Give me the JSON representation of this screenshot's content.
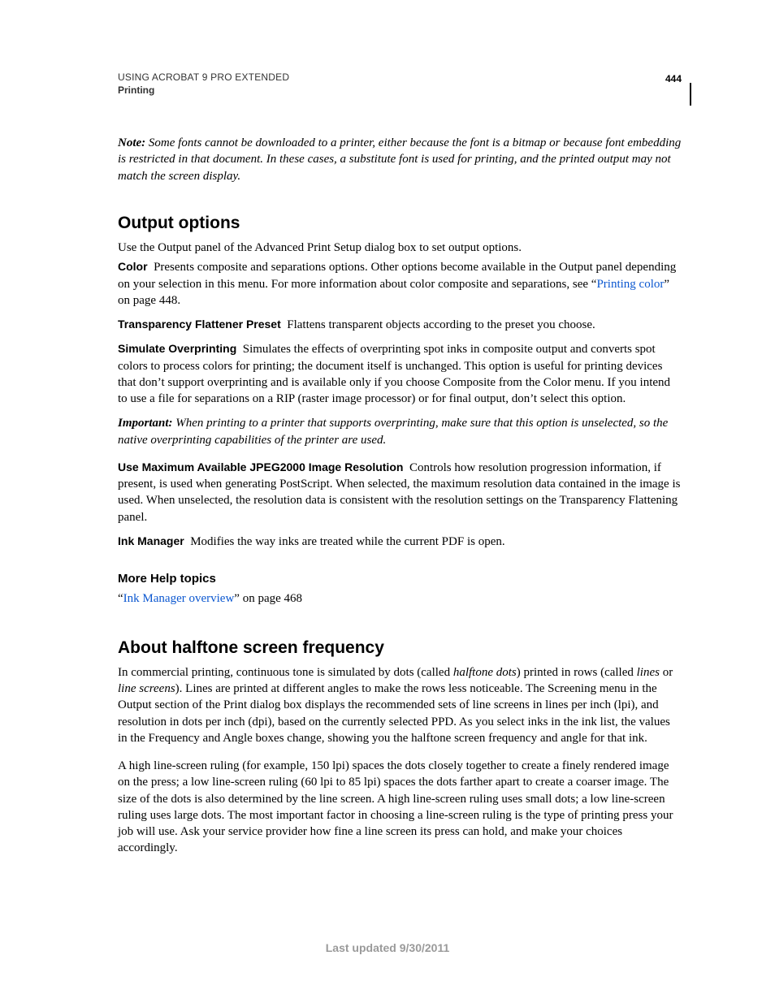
{
  "header": {
    "doc_title": "USING ACROBAT 9 PRO EXTENDED",
    "section": "Printing",
    "page_number": "444"
  },
  "note": {
    "label": "Note:",
    "text": " Some fonts cannot be downloaded to a printer, either because the font is a bitmap or because font embedding is restricted in that document. In these cases, a substitute font is used for printing, and the printed output may not match the screen display."
  },
  "sections": {
    "output_options": {
      "heading": "Output options",
      "intro": "Use the Output panel of the Advanced Print Setup dialog box to set output options.",
      "color_term": "Color",
      "color_text_a": "Presents composite and separations options. Other options become available in the Output panel depending on your selection in this menu. For more information about color composite and separations, see “",
      "color_link": "Printing color",
      "color_text_b": "” on page 448.",
      "tfp_term": "Transparency Flattener Preset",
      "tfp_text": "Flattens transparent objects according to the preset you choose.",
      "so_term": "Simulate Overprinting",
      "so_text": "Simulates the effects of overprinting spot inks in composite output and converts spot colors to process colors for printing; the document itself is unchanged. This option is useful for printing devices that don’t support overprinting and is available only if you choose Composite from the Color menu. If you intend to use a file for separations on a RIP (raster image processor) or for final output, don’t select this option.",
      "important_label": "Important:",
      "important_text": " When printing to a printer that supports overprinting, make sure that this option is unselected, so the native overprinting capabilities of the printer are used.",
      "jpeg_term": "Use Maximum Available JPEG2000 Image Resolution",
      "jpeg_text": "Controls how resolution progression information, if present, is used when generating PostScript. When selected, the maximum resolution data contained in the image is used. When unselected, the resolution data is consistent with the resolution settings on the Transparency Flattening panel.",
      "ink_term": "Ink Manager",
      "ink_text": "Modifies the way inks are treated while the current PDF is open.",
      "more_help": "More Help topics",
      "help_quote_open": "“",
      "help_link": "Ink Manager overview",
      "help_quote_close": "” on page 468"
    },
    "halftone": {
      "heading": "About halftone screen frequency",
      "p1_a": "In commercial printing, continuous tone is simulated by dots (called ",
      "p1_b": "halftone dots",
      "p1_c": ") printed in rows (called ",
      "p1_d": "lines",
      "p1_e": " or ",
      "p1_f": "line screens",
      "p1_g": "). Lines are printed at different angles to make the rows less noticeable. The Screening menu in the Output section of the Print dialog box displays the recommended sets of line screens in lines per inch (lpi), and resolution in dots per inch (dpi), based on the currently selected PPD. As you select inks in the ink list, the values in the Frequency and Angle boxes change, showing you the halftone screen frequency and angle for that ink.",
      "p2": "A high line-screen ruling (for example, 150 lpi) spaces the dots closely together to create a finely rendered image on the press; a low line-screen ruling (60 lpi to 85 lpi) spaces the dots farther apart to create a coarser image. The size of the dots is also determined by the line screen. A high line-screen ruling uses small dots; a low line-screen ruling uses large dots. The most important factor in choosing a line-screen ruling is the type of printing press your job will use. Ask your service provider how fine a line screen its press can hold, and make your choices accordingly."
    }
  },
  "footer": {
    "text": "Last updated 9/30/2011"
  }
}
